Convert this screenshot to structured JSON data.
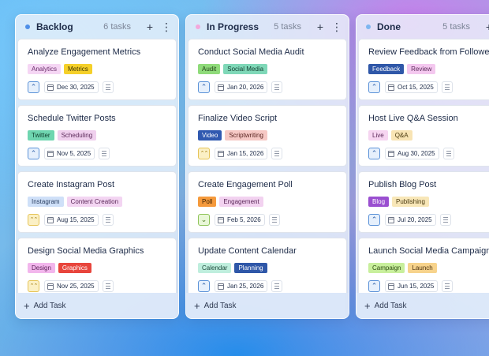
{
  "columns": [
    {
      "title": "Backlog",
      "count": "6 tasks",
      "dot": "#4f8fe8",
      "add_task": "Add Task",
      "cards": [
        {
          "title": "Analyze Engagement Metrics",
          "tags": [
            {
              "label": "Analytics",
              "bg": "#f5d6f4",
              "fg": "#6a2c6a"
            },
            {
              "label": "Metrics",
              "bg": "#f5d02a",
              "fg": "#3b3200"
            }
          ],
          "priority": "up",
          "due": "Dec 30, 2025"
        },
        {
          "title": "Schedule Twitter Posts",
          "tags": [
            {
              "label": "Twitter",
              "bg": "#6fd6b0",
              "fg": "#11402e"
            },
            {
              "label": "Scheduling",
              "bg": "#f0d0ee",
              "fg": "#5c2a5a"
            }
          ],
          "priority": "up",
          "due": "Nov 5, 2025"
        },
        {
          "title": "Create Instagram Post",
          "tags": [
            {
              "label": "Instagram",
              "bg": "#cfe0f8",
              "fg": "#2b3f62"
            },
            {
              "label": "Content Creation",
              "bg": "#f3d5f2",
              "fg": "#5c2a5a"
            }
          ],
          "priority": "high",
          "due": "Aug 15, 2025"
        },
        {
          "title": "Design Social Media Graphics",
          "tags": [
            {
              "label": "Design",
              "bg": "#f2b6ec",
              "fg": "#5a1f55"
            },
            {
              "label": "Graphics",
              "bg": "#e8453c",
              "fg": "#ffffff"
            }
          ],
          "priority": "high",
          "due": "Nov 25, 2025"
        }
      ]
    },
    {
      "title": "In Progress",
      "count": "5 tasks",
      "dot": "#f3a8dc",
      "add_task": "Add Task",
      "cards": [
        {
          "title": "Conduct Social Media Audit",
          "tags": [
            {
              "label": "Audit",
              "bg": "#8fdb7a",
              "fg": "#1f3f16"
            },
            {
              "label": "Social Media",
              "bg": "#7fd8b8",
              "fg": "#144032"
            }
          ],
          "priority": "up",
          "due": "Jan 20, 2026"
        },
        {
          "title": "Finalize Video Script",
          "tags": [
            {
              "label": "Video",
              "bg": "#3059b0",
              "fg": "#ffffff"
            },
            {
              "label": "Scriptwriting",
              "bg": "#f6c9c5",
              "fg": "#5a2420"
            }
          ],
          "priority": "high",
          "due": "Jan 15, 2026"
        },
        {
          "title": "Create Engagement Poll",
          "tags": [
            {
              "label": "Poll",
              "bg": "#f59a3c",
              "fg": "#3d2200"
            },
            {
              "label": "Engagement",
              "bg": "#f2d2f0",
              "fg": "#5c2a5a"
            }
          ],
          "priority": "down",
          "due": "Feb 5, 2026"
        },
        {
          "title": "Update Content Calendar",
          "tags": [
            {
              "label": "Calendar",
              "bg": "#bfeedd",
              "fg": "#1d4a3b"
            },
            {
              "label": "Planning",
              "bg": "#2f57a8",
              "fg": "#ffffff"
            }
          ],
          "priority": "up",
          "due": "Jan 25, 2026"
        }
      ]
    },
    {
      "title": "Done",
      "count": "5 tasks",
      "dot": "#7eb6f0",
      "add_task": "Add Task",
      "cards": [
        {
          "title": "Review Feedback from Followers",
          "tags": [
            {
              "label": "Feedback",
              "bg": "#2f57a8",
              "fg": "#ffffff"
            },
            {
              "label": "Review",
              "bg": "#f4c8ef",
              "fg": "#5c2a5a"
            }
          ],
          "priority": "up",
          "due": "Oct 15, 2025"
        },
        {
          "title": "Host Live Q&A Session",
          "tags": [
            {
              "label": "Live",
              "bg": "#f6d5f1",
              "fg": "#5c2a5a"
            },
            {
              "label": "Q&A",
              "bg": "#f8e4b4",
              "fg": "#4a3a10"
            }
          ],
          "priority": "up",
          "due": "Aug 30, 2025"
        },
        {
          "title": "Publish Blog Post",
          "tags": [
            {
              "label": "Blog",
              "bg": "#9a4fd0",
              "fg": "#ffffff"
            },
            {
              "label": "Publishing",
              "bg": "#f8e7b8",
              "fg": "#4a3a10"
            }
          ],
          "priority": "up",
          "due": "Jul 20, 2025"
        },
        {
          "title": "Launch Social Media Campaign",
          "tags": [
            {
              "label": "Campaign",
              "bg": "#c8ef9c",
              "fg": "#2c4a10"
            },
            {
              "label": "Launch",
              "bg": "#f7d38c",
              "fg": "#4a3210"
            }
          ],
          "priority": "up",
          "due": "Jun 15, 2025"
        }
      ]
    }
  ],
  "priority_styles": {
    "up": {
      "glyph": "⌃",
      "bg": "#e6f0fc",
      "border": "#5b92d8",
      "fg": "#2d5fa8"
    },
    "high": {
      "glyph": "⌃⌃",
      "bg": "#fbf0c5",
      "border": "#e6c457",
      "fg": "#9a7300"
    },
    "down": {
      "glyph": "⌄",
      "bg": "#e9f7d8",
      "border": "#8fc45a",
      "fg": "#4b7a1e"
    }
  }
}
